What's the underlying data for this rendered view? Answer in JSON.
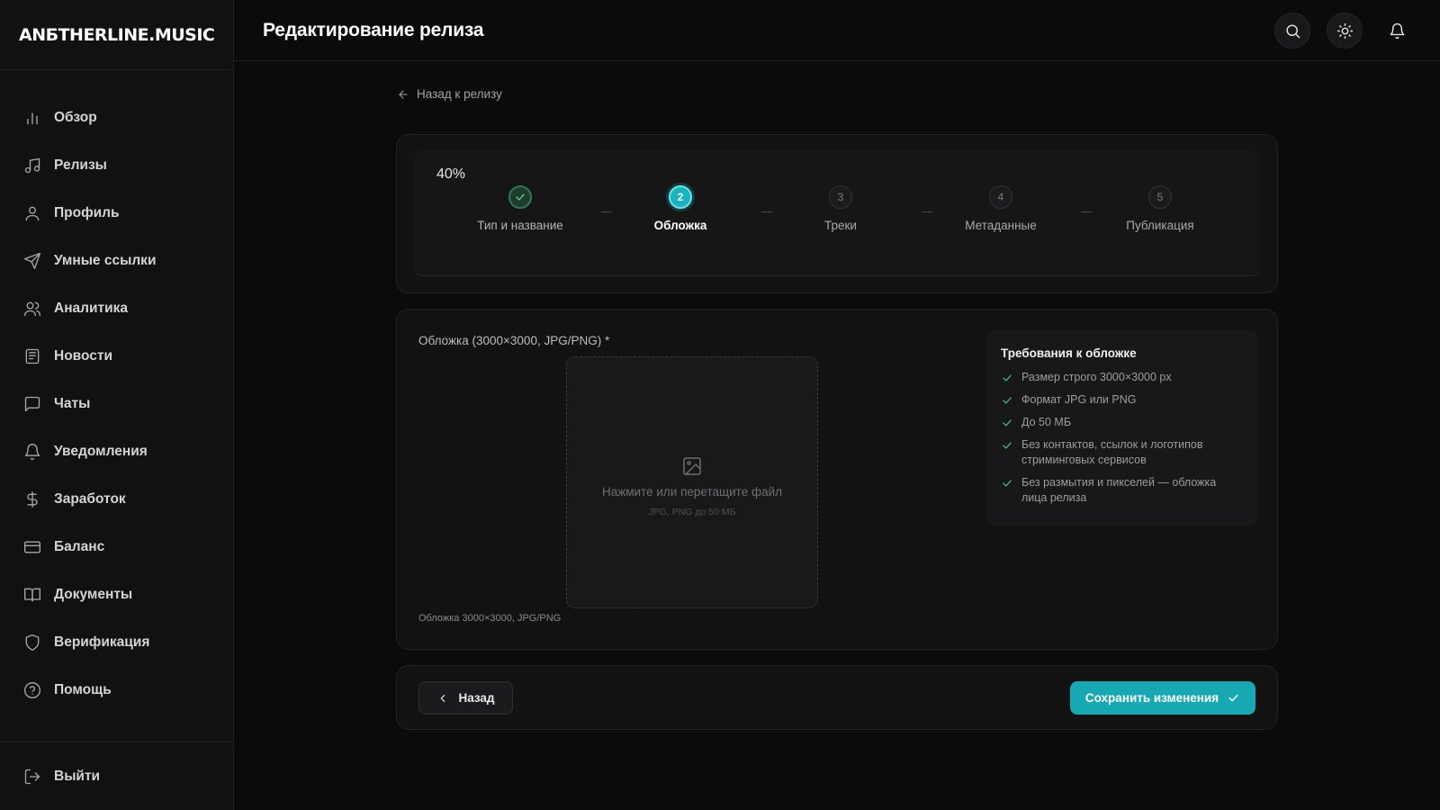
{
  "brand": {
    "logo": "ANБTHERLINE.MUSIC"
  },
  "sidebar": {
    "items": [
      {
        "label": "Обзор",
        "icon": "bar-chart-icon"
      },
      {
        "label": "Релизы",
        "icon": "music-note-icon"
      },
      {
        "label": "Профиль",
        "icon": "user-icon"
      },
      {
        "label": "Умные ссылки",
        "icon": "send-icon"
      },
      {
        "label": "Аналитика",
        "icon": "users-icon"
      },
      {
        "label": "Новости",
        "icon": "newspaper-icon"
      },
      {
        "label": "Чаты",
        "icon": "chat-icon"
      },
      {
        "label": "Уведомления",
        "icon": "bell-icon"
      },
      {
        "label": "Заработок",
        "icon": "dollar-icon"
      },
      {
        "label": "Баланс",
        "icon": "credit-card-icon"
      },
      {
        "label": "Документы",
        "icon": "book-icon"
      },
      {
        "label": "Верификация",
        "icon": "shield-icon"
      },
      {
        "label": "Помощь",
        "icon": "help-circle-icon"
      }
    ],
    "logout": {
      "label": "Выйти",
      "icon": "logout-icon"
    }
  },
  "header": {
    "title": "Редактирование релиза",
    "actions": [
      "search-icon",
      "sun-icon",
      "bell-icon"
    ]
  },
  "back_link": {
    "label": "Назад к релизу"
  },
  "stepper": {
    "percent_label": "40%",
    "progress": 0.4,
    "steps": [
      {
        "number": "1",
        "label": "Тип и название",
        "state": "done"
      },
      {
        "number": "2",
        "label": "Обложка",
        "state": "active"
      },
      {
        "number": "3",
        "label": "Треки",
        "state": "pending"
      },
      {
        "number": "4",
        "label": "Метаданные",
        "state": "pending"
      },
      {
        "number": "5",
        "label": "Публикация",
        "state": "pending"
      }
    ]
  },
  "cover": {
    "field_label": "Обложка (3000×3000, JPG/PNG) *",
    "dropzone_text": "Нажмите или перетащите файл",
    "dropzone_hint": "JPG, PNG до 50 МБ",
    "field_hint": "Обложка 3000×3000, JPG/PNG"
  },
  "requirements": {
    "title": "Требования к обложке",
    "items": [
      "Размер строго 3000×3000 px",
      "Формат JPG или PNG",
      "До 50 МБ",
      "Без контактов, ссылок и логотипов стриминговых сервисов",
      "Без размытия и пикселей — обложка лица релиза"
    ]
  },
  "actions": {
    "back_label": "Назад",
    "save_label": "Сохранить изменения"
  },
  "colors": {
    "accent": "#17a9b3",
    "success": "#3dbd7d",
    "background": "#0b0b0c",
    "surface": "#121213"
  }
}
